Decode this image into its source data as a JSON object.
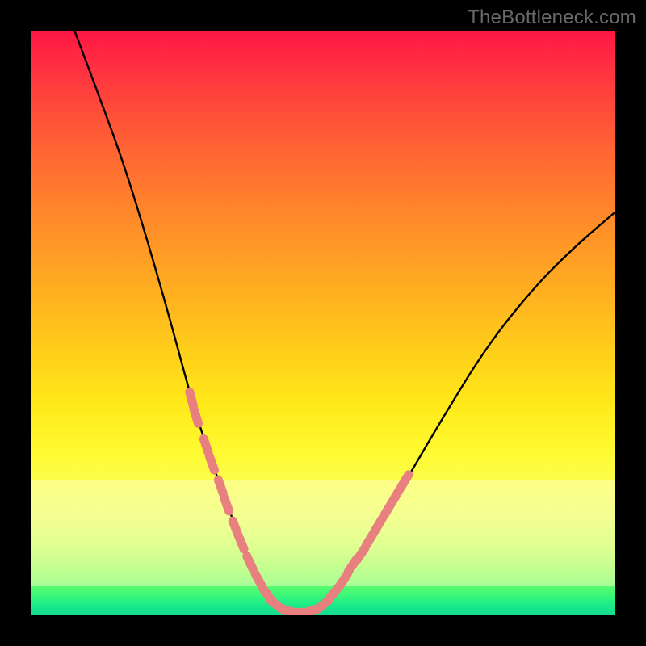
{
  "watermark": "TheBottleneck.com",
  "colors": {
    "frame": "#000000",
    "watermark_text": "#6a6a6a",
    "bead": "#e8807f",
    "curve": "#000000"
  },
  "chart_data": {
    "type": "line",
    "title": "",
    "xlabel": "",
    "ylabel": "",
    "xlim": [
      0,
      1
    ],
    "ylim": [
      0,
      1
    ],
    "note": "No axes, tick labels, or numeric data labels are visible in the image; values below are normalized estimates read from pixel geometry (0=left/bottom, 1=right/top).",
    "series": [
      {
        "name": "bottleneck-curve",
        "x": [
          0.075,
          0.12,
          0.16,
          0.2,
          0.24,
          0.275,
          0.3,
          0.325,
          0.345,
          0.365,
          0.385,
          0.405,
          0.43,
          0.455,
          0.49,
          0.53,
          0.57,
          0.63,
          0.7,
          0.78,
          0.86,
          0.93,
          1.0
        ],
        "values": [
          1.0,
          0.88,
          0.77,
          0.64,
          0.5,
          0.37,
          0.29,
          0.22,
          0.165,
          0.115,
          0.07,
          0.035,
          0.012,
          0.005,
          0.012,
          0.05,
          0.11,
          0.21,
          0.33,
          0.46,
          0.56,
          0.63,
          0.69
        ]
      }
    ],
    "minimum": {
      "x": 0.455,
      "value": 0.005
    },
    "markers": {
      "name": "beads",
      "description": "Salmon-colored pill markers along both sides of the valley near the bottom.",
      "points": [
        {
          "x": 0.275,
          "value": 0.37
        },
        {
          "x": 0.283,
          "value": 0.34
        },
        {
          "x": 0.3,
          "value": 0.29
        },
        {
          "x": 0.31,
          "value": 0.26
        },
        {
          "x": 0.325,
          "value": 0.22
        },
        {
          "x": 0.335,
          "value": 0.19
        },
        {
          "x": 0.35,
          "value": 0.15
        },
        {
          "x": 0.36,
          "value": 0.125
        },
        {
          "x": 0.375,
          "value": 0.09
        },
        {
          "x": 0.39,
          "value": 0.06
        },
        {
          "x": 0.405,
          "value": 0.035
        },
        {
          "x": 0.42,
          "value": 0.018
        },
        {
          "x": 0.44,
          "value": 0.008
        },
        {
          "x": 0.46,
          "value": 0.005
        },
        {
          "x": 0.48,
          "value": 0.008
        },
        {
          "x": 0.5,
          "value": 0.018
        },
        {
          "x": 0.52,
          "value": 0.04
        },
        {
          "x": 0.535,
          "value": 0.06
        },
        {
          "x": 0.55,
          "value": 0.085
        },
        {
          "x": 0.565,
          "value": 0.105
        },
        {
          "x": 0.58,
          "value": 0.13
        },
        {
          "x": 0.595,
          "value": 0.155
        },
        {
          "x": 0.61,
          "value": 0.18
        },
        {
          "x": 0.625,
          "value": 0.205
        },
        {
          "x": 0.64,
          "value": 0.23
        }
      ]
    },
    "pale_band": {
      "y_top": 0.23,
      "y_bottom": 0.05
    }
  }
}
